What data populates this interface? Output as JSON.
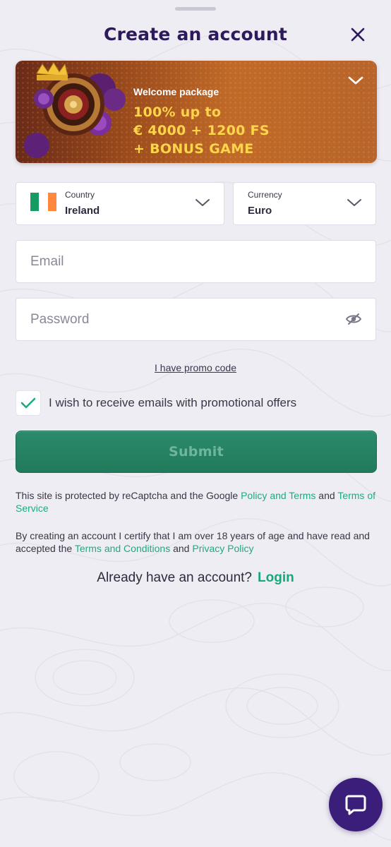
{
  "header": {
    "title": "Create an account"
  },
  "banner": {
    "label": "Welcome package",
    "offer_lines": [
      "100% up to",
      "€ 4000 + 1200 FS",
      "+ BONUS GAME"
    ]
  },
  "form": {
    "country": {
      "label": "Country",
      "value": "Ireland",
      "flag_colors": [
        "#169b62",
        "#ffffff",
        "#ff883e"
      ]
    },
    "currency": {
      "label": "Currency",
      "value": "Euro"
    },
    "email": {
      "placeholder": "Email",
      "value": ""
    },
    "password": {
      "placeholder": "Password",
      "value": ""
    },
    "promo_link": "I have promo code",
    "newsletter": {
      "label": "I wish to receive emails with promotional offers",
      "checked": true
    },
    "submit_label": "Submit"
  },
  "legal": {
    "recaptcha_text": "This site is protected by reCaptcha and the Google ",
    "policy_link": "Policy and Terms",
    "and_text": " and ",
    "tos_link": "Terms of Service",
    "age_text": "By creating an account I certify that I am over 18 years of age and have read and accepted the ",
    "terms_link": "Terms and Conditions",
    "and_text_2": " and ",
    "privacy_link": "Privacy Policy"
  },
  "footer": {
    "have_account_text": "Already have an account?",
    "login_label": "Login"
  },
  "colors": {
    "title": "#2d1a5a",
    "accent_green": "#20a981",
    "submit_bg": "#217a5c",
    "chat_bg": "#3b1e7a"
  },
  "icons": [
    "close-icon",
    "chevron-down-icon",
    "eye-off-icon",
    "check-icon",
    "chat-icon"
  ]
}
